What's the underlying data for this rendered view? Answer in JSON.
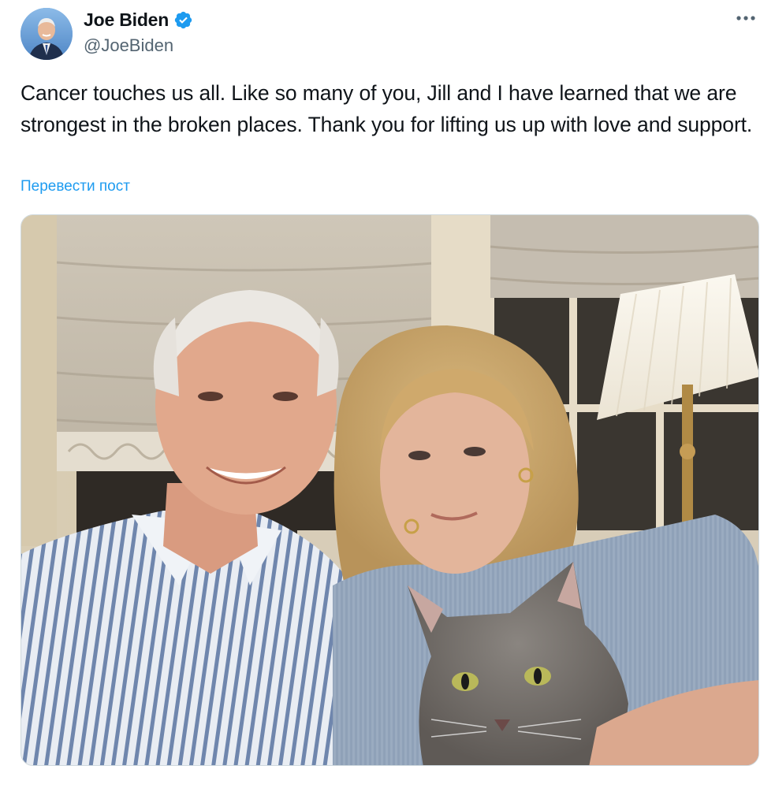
{
  "tweet": {
    "author": {
      "display_name": "Joe Biden",
      "handle": "@JoeBiden",
      "verified": true,
      "avatar_icon": "profile-photo"
    },
    "text": "Cancer touches us all. Like so many of you, Jill and I have learned that we are strongest in the broken places. Thank you for lifting us up with love and support.",
    "translate_label": "Перевести пост",
    "more_icon": "more-horizontal-icon",
    "media": {
      "type": "photo"
    }
  },
  "colors": {
    "text": "#0f1419",
    "secondary_text": "#536471",
    "link": "#1d9bf0",
    "verified_badge": "#1d9bf0",
    "border": "#cfd9de"
  }
}
